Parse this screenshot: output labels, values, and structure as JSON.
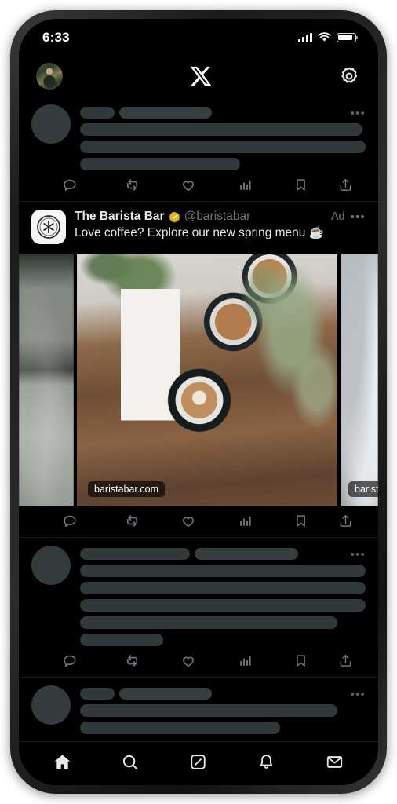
{
  "status_bar": {
    "time": "6:33",
    "signal_icon": "cellular-signal-icon",
    "wifi_icon": "wifi-icon",
    "battery_icon": "battery-icon",
    "battery_level": "85"
  },
  "app_header": {
    "profile_avatar": "profile-avatar",
    "logo": "x-logo",
    "settings_icon": "gear-icon"
  },
  "feed": {
    "skeleton_post_top": {
      "state": "loading-placeholder",
      "more_menu": "•••"
    },
    "ad_post": {
      "avatar_icon": "barista-bar-logo",
      "display_name": "The Barista Bar",
      "verified_badge": "gold-verified-badge",
      "handle": "@baristabar",
      "ad_label": "Ad",
      "more_menu": "•••",
      "text": "Love coffee? Explore our new spring menu ☕",
      "carousel": [
        {
          "id": "slide-prev",
          "domain_label": "",
          "alt": "stone-counter-photo"
        },
        {
          "id": "slide-main",
          "domain_label": "baristabar.com",
          "alt": "latte-art-cups-on-wooden-table"
        },
        {
          "id": "slide-next",
          "domain_label": "barist",
          "alt": "bright-cafe-photo"
        }
      ]
    },
    "skeleton_post_bottom": {
      "state": "loading-placeholder",
      "more_menu": "•••"
    },
    "skeleton_post_partial": {
      "state": "loading-placeholder",
      "more_menu": "•••"
    },
    "actions": [
      {
        "name": "reply-icon",
        "label": "Reply",
        "count": ""
      },
      {
        "name": "retweet-icon",
        "label": "Repost",
        "count": ""
      },
      {
        "name": "like-icon",
        "label": "Like",
        "count": ""
      },
      {
        "name": "views-icon",
        "label": "Views",
        "count": ""
      },
      {
        "name": "bookmark-icon",
        "label": "Bookmark",
        "count": ""
      },
      {
        "name": "share-icon",
        "label": "Share",
        "count": ""
      }
    ]
  },
  "bottom_nav": [
    {
      "name": "nav-home",
      "icon": "home-icon",
      "active": true
    },
    {
      "name": "nav-search",
      "icon": "search-icon",
      "active": false
    },
    {
      "name": "nav-grok",
      "icon": "grok-icon",
      "active": false
    },
    {
      "name": "nav-notifications",
      "icon": "bell-icon",
      "active": false
    },
    {
      "name": "nav-messages",
      "icon": "envelope-icon",
      "active": false
    }
  ],
  "colors": {
    "background": "#000000",
    "text_primary": "#e7e9ea",
    "text_secondary": "#71767b",
    "skeleton": "#31383a",
    "verified_gold": "#e2b719",
    "divider": "#16181c"
  }
}
